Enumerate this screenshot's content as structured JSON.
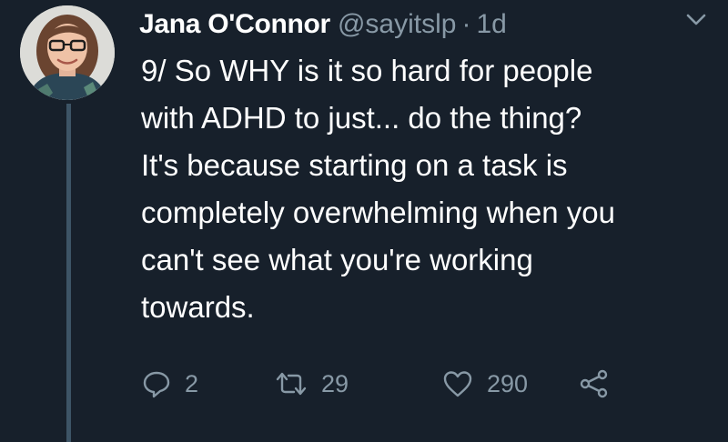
{
  "tweet": {
    "display_name": "Jana O'Connor",
    "handle": "@sayitslp",
    "separator": "·",
    "time": "1d",
    "text": "9/ So WHY is it so hard for people\nwith ADHD to just... do the thing?\nIt's because starting on a task is\ncompletely overwhelming when you\ncan't see what you're working\ntowards.",
    "avatar_icon": "profile-photo",
    "caret_icon": "chevron-down-icon"
  },
  "actions": {
    "reply": {
      "icon": "reply-icon",
      "count": "2"
    },
    "retweet": {
      "icon": "retweet-icon",
      "count": "29"
    },
    "like": {
      "icon": "heart-icon",
      "count": "290"
    },
    "share": {
      "icon": "share-icon"
    }
  },
  "colors": {
    "background": "#17202b",
    "primary_text": "#ffffff",
    "secondary_text": "#8899a6",
    "thread_line": "#3d5466"
  }
}
